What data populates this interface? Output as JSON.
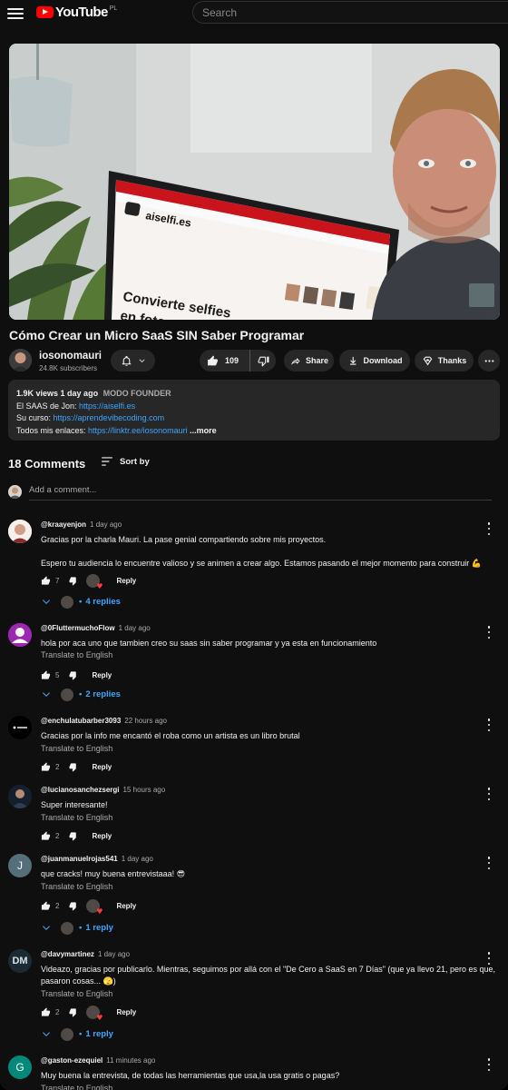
{
  "header": {
    "logo_text": "YouTube",
    "country_code": "PL",
    "search_placeholder": "Search"
  },
  "video": {
    "title": "Cómo Crear un Micro SaaS SIN Saber Programar",
    "screen_brand": "aiselfi.es",
    "screen_headline_1": "Convierte selfies",
    "screen_headline_2": "en fotos profesionales"
  },
  "channel": {
    "name": "iosonomauri",
    "subscribers": "24.8K subscribers"
  },
  "actions": {
    "likes": "109",
    "share": "Share",
    "download": "Download",
    "thanks": "Thanks"
  },
  "description": {
    "views": "1.9K views",
    "age": "1 day ago",
    "tag": "MODO FOUNDER",
    "line1_label": "El SAAS de Jon: ",
    "line1_link": "https://aiselfi.es",
    "line2_label": "Su curso: ",
    "line2_link": "https://aprendevibecoding.com",
    "line3_label": "Todos mis enlaces: ",
    "line3_link": "https://linktr.ee/iosonomauri",
    "more": "...more"
  },
  "comments_section": {
    "count": "18 Comments",
    "sort_label": "Sort by",
    "add_placeholder": "Add a comment...",
    "translate_label": "Translate to English",
    "reply_label": "Reply"
  },
  "comments": [
    {
      "author": "@kraayenjon",
      "time": "1 day ago",
      "text_1": "Gracias por la charla Mauri. La pase genial compartiendo sobre mis proyectos.",
      "text_2": "Espero tu audiencia lo encuentre valioso y se animen a crear algo. Estamos pasando el mejor momento para construir 💪",
      "likes": "7",
      "replies": "4 replies"
    },
    {
      "author": "@0FluttermuchoFlow",
      "time": "1 day ago",
      "text": "hola por aca uno que tambien creo su saas sin saber programar y ya esta en funcionamiento",
      "likes": "5",
      "replies": "2 replies"
    },
    {
      "author": "@enchulatubarber3093",
      "time": "22 hours ago",
      "text": "Gracias por la info me encantó el roba como un artista es un libro brutal",
      "likes": "2"
    },
    {
      "author": "@lucianosanchezsergi",
      "time": "15 hours ago",
      "text": "Super interesante!",
      "likes": "2"
    },
    {
      "author": "@juanmanuelrojas541",
      "time": "1 day ago",
      "avatar_letter": "J",
      "text": "que cracks! muy buena entrevistaaa! 😎",
      "likes": "2",
      "replies": "1 reply"
    },
    {
      "author": "@davymartinez",
      "time": "1 day ago",
      "avatar_letter": "DM",
      "text": "Videazo, gracias por publicarlo. Mientras, seguimos por allá con el \"De Cero a SaaS en 7 Días\" (que ya llevo 21, pero es que, pasaron cosas... 🫣)",
      "likes": "2",
      "replies": "1 reply"
    },
    {
      "author": "@gaston-ezequiel",
      "time": "11 minutes ago",
      "avatar_letter": "G",
      "text": "Muy buena la entrevista, de todas las herramientas que usa,la usa gratis o pagas?"
    }
  ],
  "colors": {
    "background": "#0f0f0f",
    "surface": "#272727",
    "link": "#3ea6ff",
    "brand_red": "#ff0000"
  }
}
